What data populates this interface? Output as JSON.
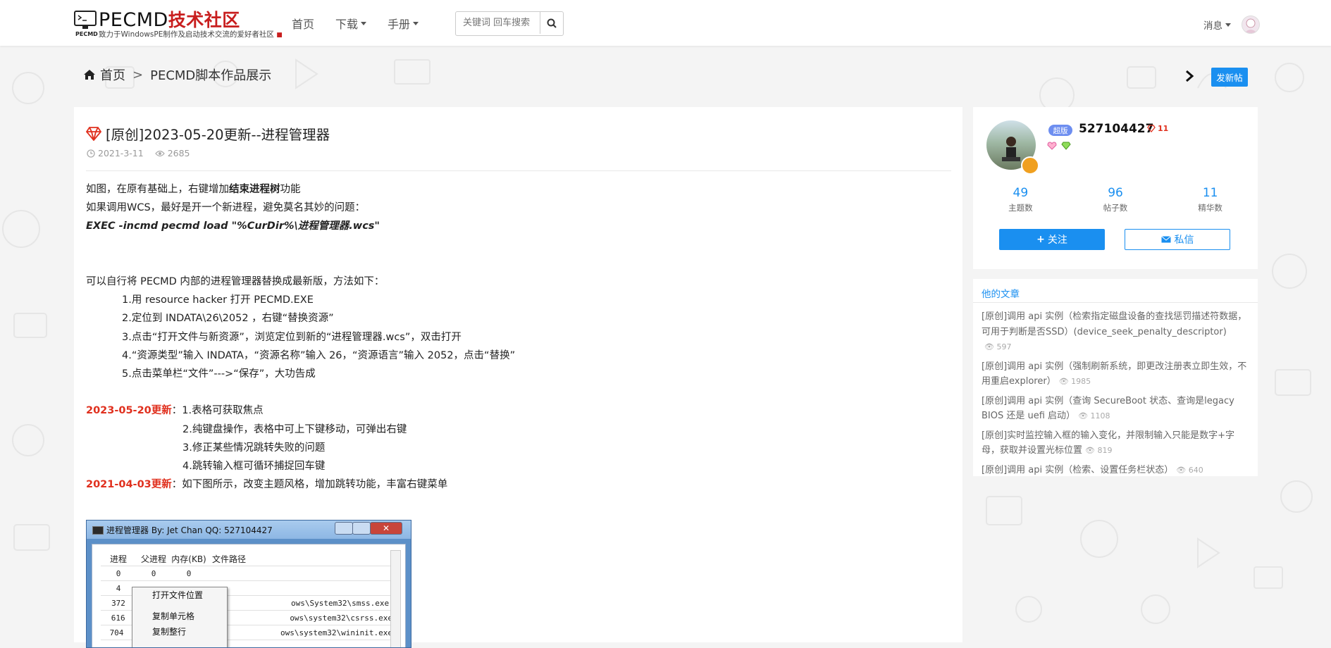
{
  "header": {
    "logo_text": "PECMD",
    "logo_cn": "技术社区",
    "logo_tag": "PECMD",
    "logo_subtitle": "致力于WindowsPE制作及启动技术交流的爱好者社区",
    "nav": [
      {
        "label": "首页",
        "dropdown": false
      },
      {
        "label": "下载",
        "dropdown": true
      },
      {
        "label": "手册",
        "dropdown": true
      }
    ],
    "search_placeholder": "关键词 回车搜索",
    "messages_label": "消息"
  },
  "breadcrumb": {
    "home": "首页",
    "separator": ">",
    "current": "PECMD脚本作品展示"
  },
  "new_post_label": "发新帖",
  "post": {
    "title": "[原创]2023-05-20更新--进程管理器",
    "date": "2021-3-11",
    "views": "2685",
    "line1_pre": "如图，在原有基础上，右键增加",
    "line1_bold": "结束进程树",
    "line1_post": "功能",
    "line2": "如果调用WCS，最好是开一个新进程，避免莫名其妙的问题：",
    "line3": "EXEC -incmd pecmd load \"%CurDir%\\进程管理器.wcs\"",
    "line4": "可以自行将 PECMD 内部的进程管理器替换成最新版，方法如下：",
    "steps": [
      "1.用 resource hacker 打开 PECMD.EXE",
      "2.定位到 INDATA\\26\\2052 ，右键“替换资源”",
      "3.点击“打开文件与新资源”，浏览定位到新的“进程管理器.wcs”，双击打开",
      "4.“资源类型”输入 INDATA，“资源名称”输入 26，“资源语言”输入 2052，点击“替换”",
      "5.点击菜单栏“文件”--->“保存”，大功告成"
    ],
    "update1_date": "2023-05-20更新",
    "update1_items": [
      "1.表格可获取焦点",
      "2.纯键盘操作，表格中可上下键移动，可弹出右键",
      "3.修正某些情况跳转失败的问题",
      "4.跳转输入框可循环捕捉回车键"
    ],
    "update2_date": "2021-04-03更新",
    "update2_text": "如下图所示，改变主题风格，增加跳转功能，丰富右键菜单",
    "screenshot": {
      "title": "进程管理器   By: Jet Chan   QQ: 527104427",
      "columns": [
        "进程",
        "父进程",
        "内存(KB)",
        "文件路径"
      ],
      "rows": [
        [
          "0",
          "0",
          "0",
          ""
        ],
        [
          "4",
          "",
          "",
          ""
        ],
        [
          "372",
          "",
          "",
          "ows\\System32\\smss.exe"
        ],
        [
          "616",
          "",
          "",
          "ows\\system32\\csrss.exe"
        ],
        [
          "704",
          "",
          "",
          "ows\\system32\\wininit.exe"
        ]
      ],
      "menu": [
        "打开文件位置",
        "复制单元格",
        "复制整行"
      ]
    }
  },
  "user": {
    "tag": "超版",
    "name": "527104427",
    "level": "11",
    "stats": [
      {
        "value": "49",
        "label": "主题数"
      },
      {
        "value": "96",
        "label": "帖子数"
      },
      {
        "value": "11",
        "label": "精华数"
      }
    ],
    "follow_label": "关注",
    "pm_label": "私信"
  },
  "articles": {
    "title": "他的文章",
    "items": [
      {
        "text": "[原创]调用 api 实例（检索指定磁盘设备的查找惩罚描述符数据，可用于判断是否SSD）(device_seek_penalty_descriptor)",
        "views": "597"
      },
      {
        "text": "[原创]调用 api 实例（强制刷新系统，即更改注册表立即生效，不用重启explorer）",
        "views": "1985"
      },
      {
        "text": "[原创]调用 api 实例（查询 SecureBoot 状态、查询是legacy BIOS 还是 uefi 启动）",
        "views": "1108"
      },
      {
        "text": "[原创]实时监控输入框的输入变化，并限制输入只能是数字+字母，获取并设置光标位置",
        "views": "819"
      },
      {
        "text": "[原创]调用 api 实例（检索、设置任务栏状态）",
        "views": "640"
      }
    ]
  },
  "colors": {
    "accent": "#1a8ff0",
    "red": "#e0301e",
    "tag": "#6d8ef0"
  }
}
